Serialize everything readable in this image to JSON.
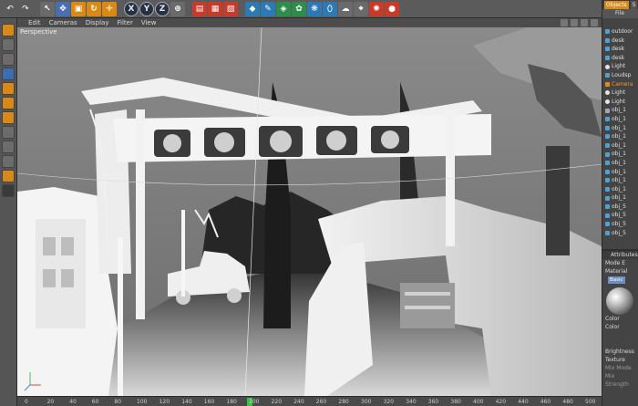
{
  "menubar": {
    "items": [
      "Edit",
      "Cameras",
      "Display",
      "Filter",
      "View"
    ]
  },
  "toolbar": {
    "axis_x": "X",
    "axis_y": "Y",
    "axis_z": "Z"
  },
  "viewport": {
    "label": "Perspective"
  },
  "timeline": {
    "ticks": [
      "0",
      "20",
      "40",
      "60",
      "80",
      "100",
      "120",
      "140",
      "160",
      "180",
      "200",
      "220",
      "240",
      "260",
      "280",
      "300",
      "320",
      "340",
      "360",
      "380",
      "400",
      "420",
      "440",
      "460",
      "480",
      "500"
    ],
    "playhead_frame": 200
  },
  "right_panel": {
    "tabs": [
      "Objects",
      "S"
    ],
    "menu": "File",
    "objects": [
      {
        "name": "outdoor",
        "icon": "object-icon"
      },
      {
        "name": "desk",
        "icon": "object-icon"
      },
      {
        "name": "desk",
        "icon": "object-icon"
      },
      {
        "name": "desk",
        "icon": "object-icon"
      },
      {
        "name": "Light",
        "icon": "light-icon"
      },
      {
        "name": "Loudsp",
        "icon": "object-icon"
      },
      {
        "name": "Camera",
        "icon": "camera-icon"
      },
      {
        "name": "Light",
        "icon": "light-icon"
      },
      {
        "name": "Light",
        "icon": "light-icon"
      },
      {
        "name": "obj_1",
        "icon": "group-icon"
      },
      {
        "name": "obj_1",
        "icon": "object-icon"
      },
      {
        "name": "obj_1",
        "icon": "object-icon"
      },
      {
        "name": "obj_1",
        "icon": "object-icon"
      },
      {
        "name": "obj_1",
        "icon": "object-icon"
      },
      {
        "name": "obj_1",
        "icon": "object-icon"
      },
      {
        "name": "obj_1",
        "icon": "object-icon"
      },
      {
        "name": "obj_1",
        "icon": "object-icon"
      },
      {
        "name": "obj_1",
        "icon": "object-icon"
      },
      {
        "name": "obj_1",
        "icon": "object-icon"
      },
      {
        "name": "obj_1",
        "icon": "object-icon"
      },
      {
        "name": "obj_5",
        "icon": "object-icon"
      },
      {
        "name": "obj_5",
        "icon": "object-icon"
      },
      {
        "name": "obj_5",
        "icon": "object-icon"
      },
      {
        "name": "obj_5",
        "icon": "object-icon"
      }
    ],
    "attributes": {
      "header": "Attributes",
      "mode": "Mode",
      "mode_tab": "E",
      "material_label": "Material",
      "basic_tab": "Basic",
      "color_section": "Color",
      "color_field": "Color",
      "brightness": "Brightness",
      "texture": "Texture",
      "mix_mode": "Mix Mode",
      "mix_strength": "Mix Strength"
    }
  },
  "colors": {
    "accent": "#d98a16",
    "selection": "#f29a2e",
    "playhead": "#38c045"
  }
}
